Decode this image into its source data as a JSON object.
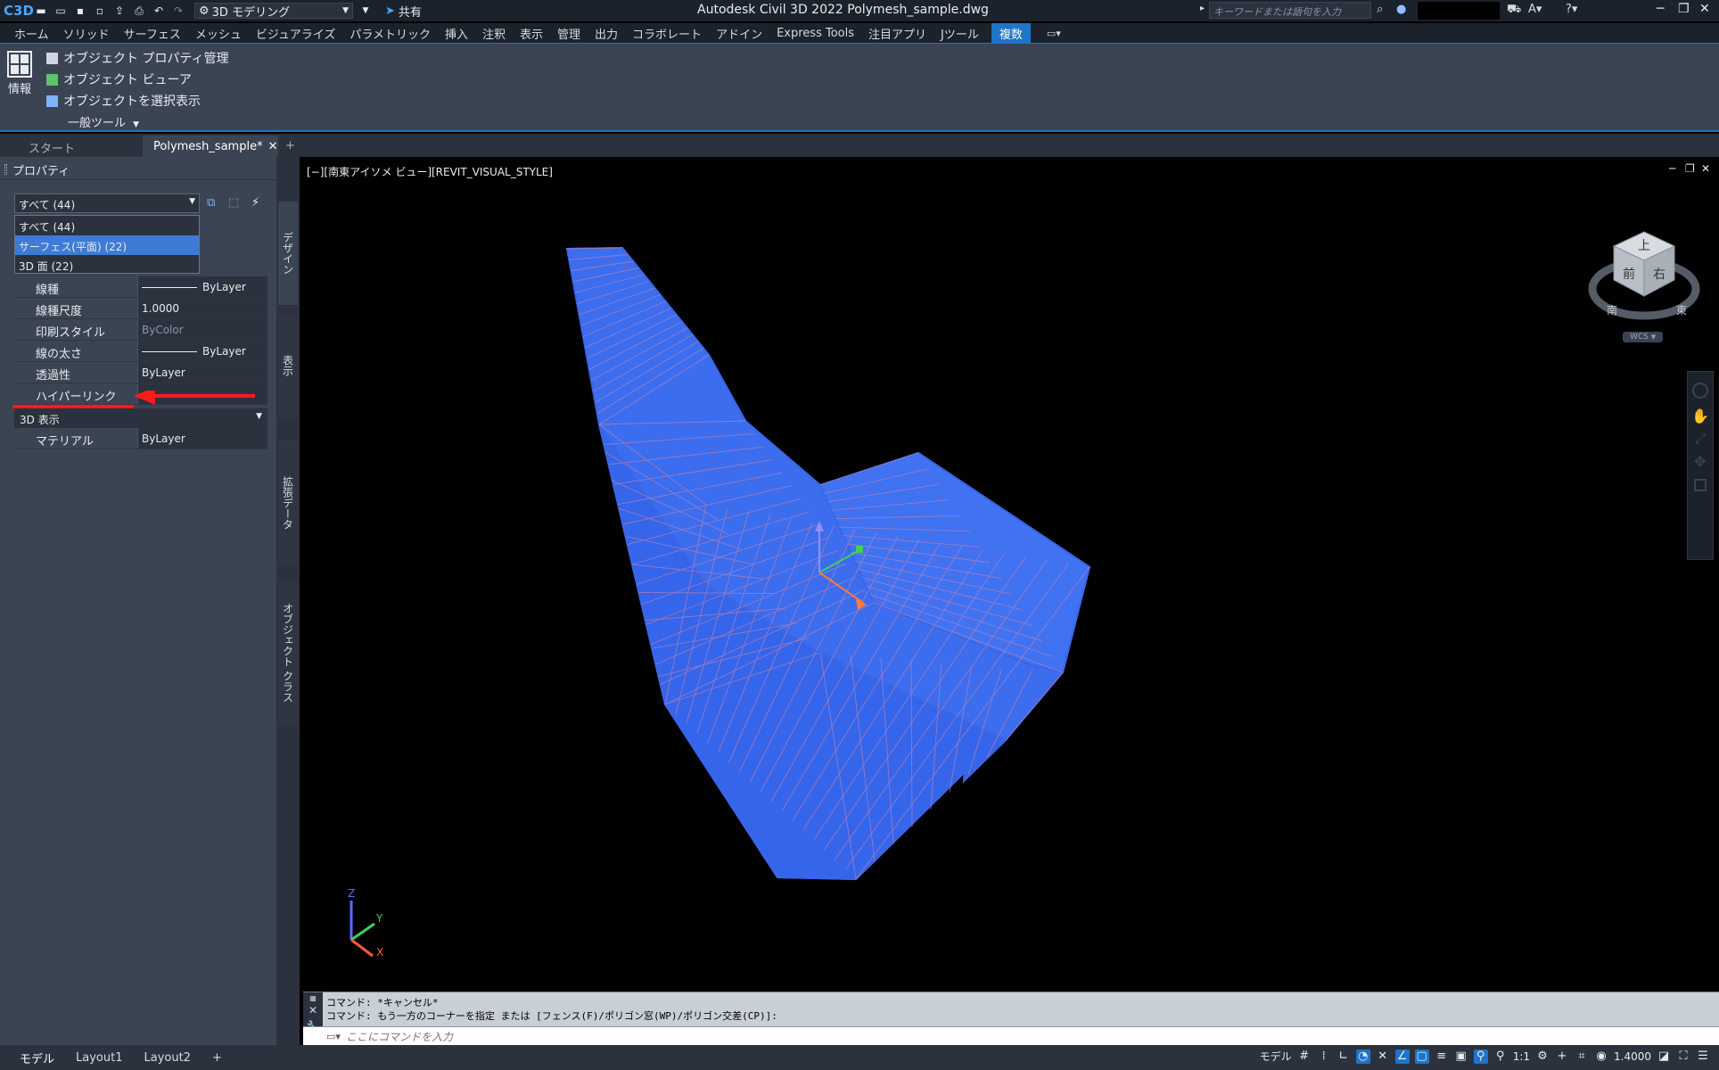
{
  "titlebar": {
    "app_logo": "C3D",
    "workspace": "3D モデリング",
    "share": "共有",
    "title": "Autodesk Civil 3D 2022    Polymesh_sample.dwg",
    "search_placeholder": "キーワードまたは語句を入力"
  },
  "ribbon_tabs": [
    "ホーム",
    "ソリッド",
    "サーフェス",
    "メッシュ",
    "ビジュアライズ",
    "パラメトリック",
    "挿入",
    "注釈",
    "表示",
    "管理",
    "出力",
    "コラボレート",
    "アドイン",
    "Express Tools",
    "注目アプリ",
    "Jツール"
  ],
  "ribbon_active_tab": "複数",
  "ribbon_panel": {
    "info_label": "情報",
    "cmd1": "オブジェクト プロパティ管理",
    "cmd2": "オブジェクト ビューア",
    "cmd3": "オブジェクトを選択表示",
    "footer": "一般ツール"
  },
  "doc_tabs": {
    "start": "スタート",
    "active": "Polymesh_sample*",
    "add": "+"
  },
  "palette": {
    "title": "プロパティ",
    "selection": "すべて (44)",
    "dropdown_options": [
      "すべて (44)",
      "サーフェス(平面) (22)",
      "3D 面 (22)"
    ],
    "highlighted_option_index": 1,
    "properties": [
      {
        "name": "線種",
        "value": "ByLayer",
        "line": true
      },
      {
        "name": "線種尺度",
        "value": "1.0000"
      },
      {
        "name": "印刷スタイル",
        "value": "ByColor",
        "dim": true
      },
      {
        "name": "線の太さ",
        "value": "ByLayer",
        "line": true
      },
      {
        "name": "透過性",
        "value": "ByLayer"
      },
      {
        "name": "ハイパーリンク",
        "value": ""
      }
    ],
    "category_3d": "3D 表示",
    "material_name": "マテリアル",
    "material_value": "ByLayer",
    "side_tabs": [
      "デザイン",
      "表示",
      "拡張データ",
      "オブジェクト クラス"
    ]
  },
  "viewport": {
    "label": "[−][南東アイソメ ビュー][REVIT_VISUAL_STYLE]",
    "viewcube": {
      "top": "上",
      "front": "前",
      "right": "右",
      "south": "南",
      "east": "東"
    },
    "wcs": "WCS",
    "ucs": {
      "x": "X",
      "y": "Y",
      "z": "Z"
    }
  },
  "cmdline": {
    "history1": "コマンド: *キャンセル*",
    "history2": "コマンド: もう一方のコーナーを指定 または [フェンス(F)/ポリゴン窓(WP)/ポリゴン交差(CP)]:",
    "placeholder": "ここにコマンドを入力"
  },
  "statusbar": {
    "layouts": [
      "モデル",
      "Layout1",
      "Layout2"
    ],
    "model_label": "モデル",
    "scale": "1:1",
    "value": "1.4000"
  },
  "colors": {
    "accent": "#1e74c9",
    "mesh_fill": "#3b6dee",
    "mesh_line": "#c983b0",
    "arrow": "#ff1a1a"
  }
}
